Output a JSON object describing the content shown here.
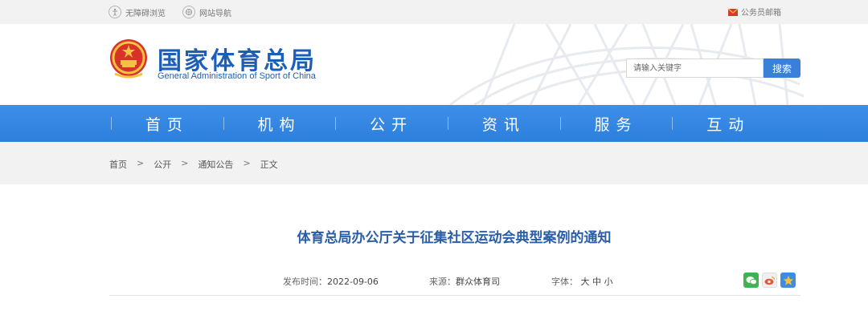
{
  "topbar": {
    "accessibility": "无障碍浏览",
    "site_nav": "网站导航",
    "mail": "公务员邮箱"
  },
  "header": {
    "site_name_cn": "国家体育总局",
    "site_name_en": "General Administration of Sport of China",
    "search_placeholder": "请输入关键字",
    "search_button": "搜索"
  },
  "nav": {
    "items": [
      {
        "label": "首页"
      },
      {
        "label": "机构"
      },
      {
        "label": "公开"
      },
      {
        "label": "资讯"
      },
      {
        "label": "服务"
      },
      {
        "label": "互动"
      }
    ]
  },
  "breadcrumb": {
    "items": [
      "首页",
      "公开",
      "通知公告",
      "正文"
    ],
    "separator": ">"
  },
  "article": {
    "title": "体育总局办公厅关于征集社区运动会典型案例的通知",
    "publish_label": "发布时间：",
    "publish_date": "2022-09-06",
    "source_label": "来源：",
    "source": "群众体育司",
    "font_label": "字体：",
    "font_large": "大",
    "font_medium": "中",
    "font_small": "小"
  },
  "share": [
    {
      "icon": "wechat-icon",
      "color": "#3fb34f"
    },
    {
      "icon": "weibo-icon",
      "color": "#e8563f"
    },
    {
      "icon": "qzone-icon",
      "color": "#3c8de0"
    }
  ],
  "colors": {
    "brand_blue": "#1d5fb6",
    "nav_blue": "#3585e2",
    "title_blue": "#2a5ea8"
  }
}
